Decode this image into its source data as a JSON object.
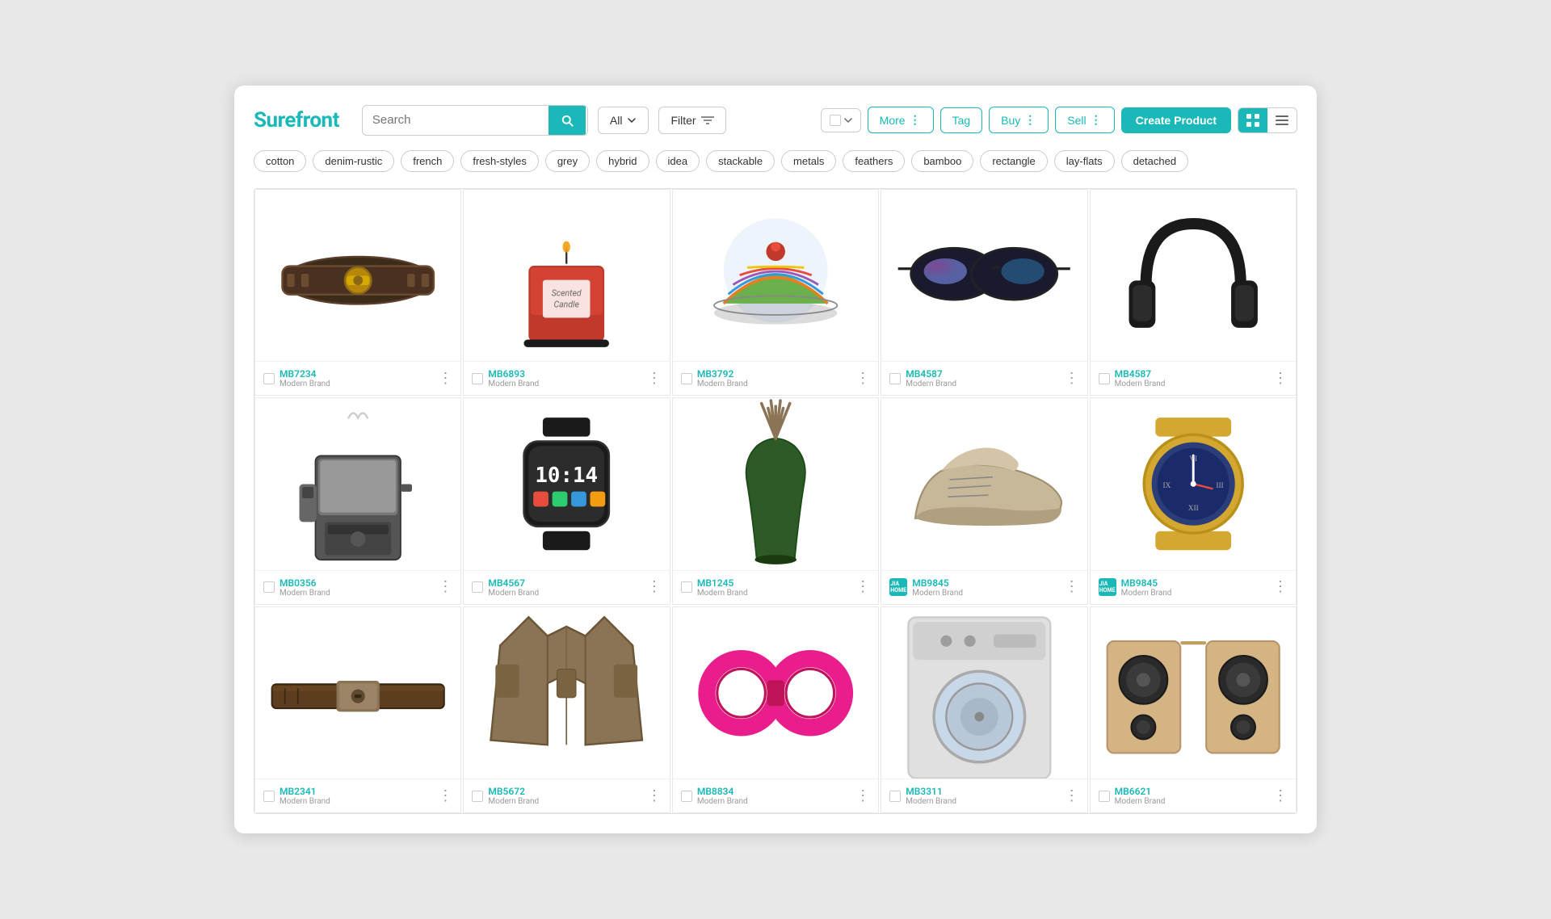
{
  "app": {
    "title": "Surefront",
    "logo": "Surefront"
  },
  "header": {
    "search_placeholder": "Search",
    "dropdown_label": "All",
    "filter_label": "Filter",
    "more_label": "More",
    "tag_label": "Tag",
    "buy_label": "Buy",
    "sell_label": "Sell",
    "create_label": "Create Product"
  },
  "tags": [
    "cotton",
    "denim-rustic",
    "french",
    "fresh-styles",
    "grey",
    "hybrid",
    "idea",
    "stackable",
    "metals",
    "feathers",
    "bamboo",
    "rectangle",
    "lay-flats",
    "detached"
  ],
  "products": [
    {
      "id": "MB7234",
      "brand": "Modern Brand",
      "type": "belt",
      "emoji": "🥋",
      "has_badge": false
    },
    {
      "id": "MB6893",
      "brand": "Modern Brand",
      "type": "candle",
      "emoji": "🕯️",
      "has_badge": false
    },
    {
      "id": "MB3792",
      "brand": "Modern Brand",
      "type": "hat",
      "emoji": "🧢",
      "has_badge": false
    },
    {
      "id": "MB4587",
      "brand": "Modern Brand",
      "type": "sunglasses",
      "emoji": "🕶️",
      "has_badge": false
    },
    {
      "id": "MB4587",
      "brand": "Modern Brand",
      "type": "headphones",
      "emoji": "🎧",
      "has_badge": false
    },
    {
      "id": "MB0356",
      "brand": "Modern Brand",
      "type": "coffee",
      "emoji": "☕",
      "has_badge": false
    },
    {
      "id": "MB4567",
      "brand": "Modern Brand",
      "type": "smartwatch",
      "emoji": "⌚",
      "has_badge": false
    },
    {
      "id": "MB1245",
      "brand": "Modern Brand",
      "type": "diffuser",
      "emoji": "🪔",
      "has_badge": false
    },
    {
      "id": "MB9845",
      "brand": "Modern Brand",
      "type": "shoe",
      "emoji": "👟",
      "has_badge": true
    },
    {
      "id": "MB9845",
      "brand": "Modern Brand",
      "type": "watch",
      "emoji": "⌚",
      "has_badge": true
    },
    {
      "id": "MB2341",
      "brand": "Modern Brand",
      "type": "belt2",
      "emoji": "👔",
      "has_badge": false
    },
    {
      "id": "MB5672",
      "brand": "Modern Brand",
      "type": "jacket",
      "emoji": "🧥",
      "has_badge": false
    },
    {
      "id": "MB8834",
      "brand": "Modern Brand",
      "type": "cuffs",
      "emoji": "💍",
      "has_badge": false
    },
    {
      "id": "MB3311",
      "brand": "Modern Brand",
      "type": "washer",
      "emoji": "🧺",
      "has_badge": false
    },
    {
      "id": "MB6621",
      "brand": "Modern Brand",
      "type": "speakers",
      "emoji": "🔊",
      "has_badge": false
    }
  ]
}
